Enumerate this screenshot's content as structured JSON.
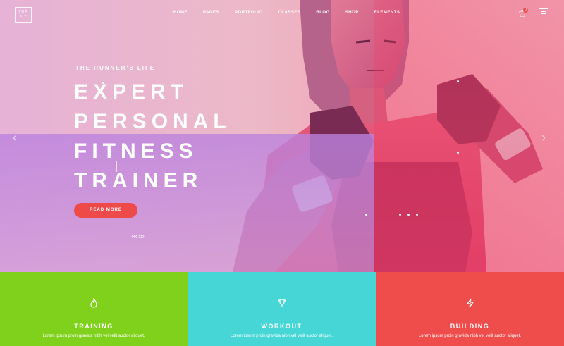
{
  "logo": {
    "line1": "TOP",
    "line2": "FIT"
  },
  "nav": {
    "items": [
      "HOME",
      "PAGES",
      "PORTFOLIO",
      "CLASSES",
      "BLOG",
      "SHOP",
      "ELEMENTS"
    ]
  },
  "cart": {
    "count": "0"
  },
  "hero": {
    "kicker": "THE RUNNER'S LIFE",
    "headline": [
      "EXPERT",
      "PERSONAL",
      "FITNESS",
      "TRAINER"
    ],
    "cta": "READ MORE",
    "slider_arrows": {
      "left": "‹",
      "right": "›"
    },
    "slider_control": "‹‹‹ ›››"
  },
  "features": [
    {
      "title": "TRAINING",
      "desc": "Lorem ipsum proin gravida nibh vel velit auctor aliquet.",
      "color": "#7fd11b",
      "icon": "flame-icon"
    },
    {
      "title": "WORKOUT",
      "desc": "Lorem ipsum proin gravida nibh vel velit auctor aliquet.",
      "color": "#46d6d6",
      "icon": "trophy-icon"
    },
    {
      "title": "BUILDING",
      "desc": "Lorem ipsum proin gravida nibh vel velit auctor aliquet.",
      "color": "#ef4c4c",
      "icon": "lightning-icon"
    }
  ],
  "colors": {
    "accent": "#ee4a4a",
    "green": "#7fd11b",
    "cyan": "#46d6d6",
    "red": "#ef4c4c"
  }
}
